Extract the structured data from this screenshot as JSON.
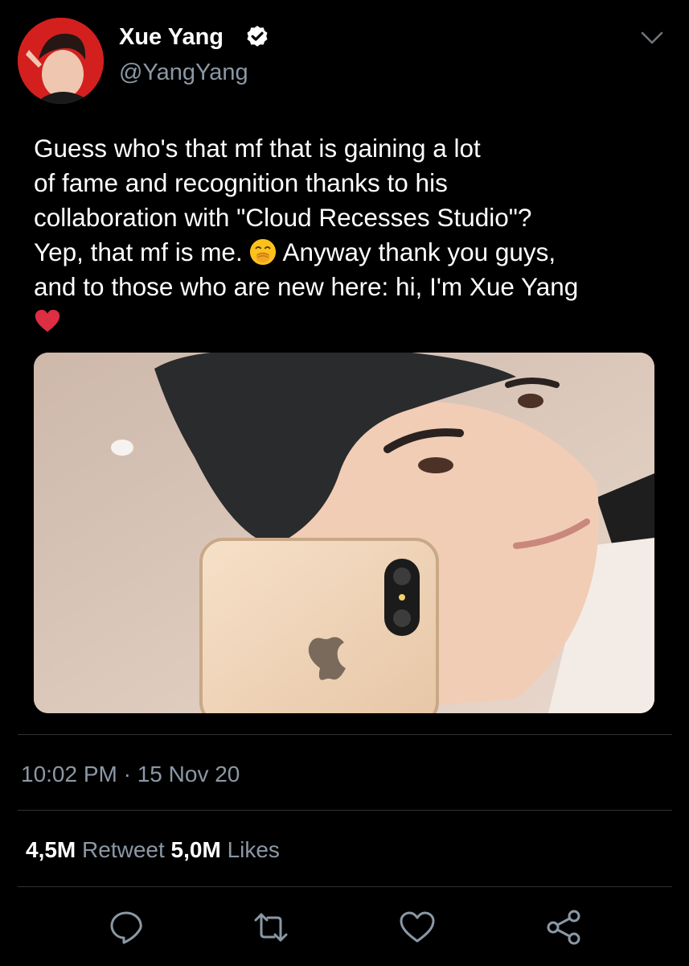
{
  "author": {
    "display_name": "Xue Yang",
    "handle": "@YangYang",
    "verified": true
  },
  "tweet": {
    "text_lines": [
      "Guess who's that mf that is gaining a lot",
      "of fame and recognition thanks to his",
      "collaboration with \"Cloud Recesses Studio\"?",
      "Yep, that mf is me.",
      "Anyway thank you guys,",
      "and to those who are new here: hi, I'm Xue Yang"
    ],
    "emojis": [
      "face-with-hand-over-mouth-emoji",
      "red-heart-emoji"
    ]
  },
  "meta": {
    "timestamp": "10:02 PM · 15 Nov 20"
  },
  "stats": {
    "retweets_count": "4,5M",
    "retweets_label": "Retweet",
    "likes_count": "5,0M",
    "likes_label": "Likes"
  },
  "actions": [
    "reply-icon",
    "retweet-icon",
    "like-icon",
    "share-icon"
  ],
  "colors": {
    "background": "#000000",
    "text": "#ffffff",
    "secondary_text": "#8b98a5",
    "divider": "#2f3336",
    "verified_badge": "#ffffff"
  }
}
